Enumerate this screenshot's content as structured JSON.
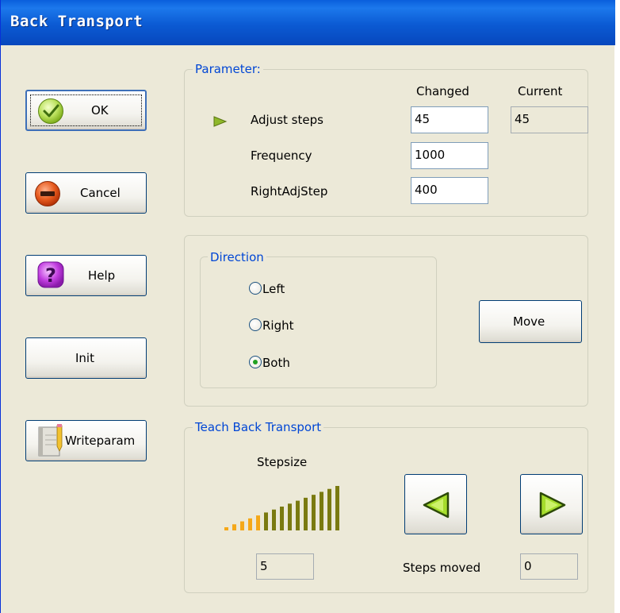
{
  "window": {
    "title": "Back Transport"
  },
  "buttons": {
    "ok": "OK",
    "cancel": "Cancel",
    "help": "Help",
    "init": "Init",
    "writeparam": "Writeparam"
  },
  "parameter": {
    "title": "Parameter:",
    "col_changed": "Changed",
    "col_current": "Current",
    "rows": [
      {
        "label": "Adjust steps",
        "changed": "45",
        "current": "45"
      },
      {
        "label": "Frequency",
        "changed": "1000"
      },
      {
        "label": "RightAdjStep",
        "changed": "400"
      }
    ]
  },
  "direction": {
    "title": "Direction",
    "options": [
      "Left",
      "Right",
      "Both"
    ],
    "selected": "Both"
  },
  "move_button": "Move",
  "teach": {
    "title": "Teach Back Transport",
    "stepsize_label": "Stepsize",
    "stepsize_value": "5",
    "steps_moved_label": "Steps moved",
    "steps_moved_value": "0",
    "stepsize_level": 5,
    "stepsize_max": 15
  },
  "icons": {
    "ok": "check-icon",
    "cancel": "minus-circle-icon",
    "help": "question-icon",
    "writeparam": "notebook-pencil-icon",
    "row_pointer": "triangle-right-icon",
    "left": "arrow-left-icon",
    "right": "arrow-right-icon"
  },
  "colors": {
    "titlebar": "#0a5fdc",
    "group_title": "#0046d5",
    "arrow_green": "#9bd42a",
    "bar_active": "#f5a818",
    "bar_inactive": "#7a7a10"
  }
}
